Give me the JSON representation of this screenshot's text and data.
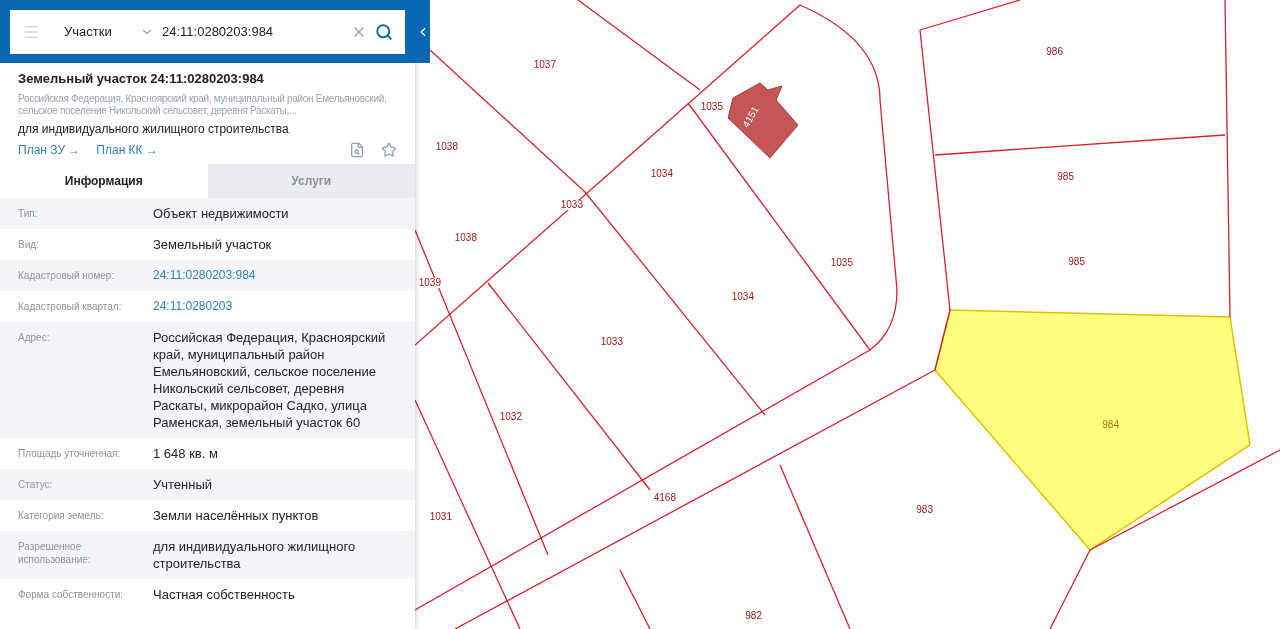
{
  "search": {
    "category": "Участки",
    "value": "24:11:0280203:984"
  },
  "card": {
    "title": "Земельный участок 24:11:0280203:984",
    "address": "Российская Федерация, Красноярский край, муниципальный район Емельяновский, сельское поселение Никольский сельсовет, деревня Раскаты,...",
    "purpose": "для индивидуального жилищного строительства",
    "links": [
      "План ЗУ →",
      "План КК →"
    ]
  },
  "tabs": [
    {
      "label": "Информация",
      "selected": true
    },
    {
      "label": "Услуги",
      "selected": false
    }
  ],
  "rows": [
    {
      "label": "Тип:",
      "value": "Объект недвижимости",
      "kind": "text"
    },
    {
      "label": "Вид:",
      "value": "Земельный участок",
      "kind": "text"
    },
    {
      "label": "Кадастровый номер:",
      "value": "24:11:0280203:984",
      "kind": "link"
    },
    {
      "label": "Кадастровый квартал:",
      "value": "24:11:0280203",
      "kind": "link"
    },
    {
      "label": "Адрес:",
      "value": "Российская Федерация, Красноярский край, муниципальный район Емельяновский, сельское поселение Никольский сельсовет, деревня Раскаты, микрорайон Садко, улица Раменская, земельный участок 60",
      "kind": "text"
    },
    {
      "label": "Площадь уточненная:",
      "value": "1 648 кв. м",
      "kind": "text"
    },
    {
      "label": "Статус:",
      "value": "Учтенный",
      "kind": "text"
    },
    {
      "label": "Категория земель:",
      "value": "Земли населённых пунктов",
      "kind": "text"
    },
    {
      "label": "Разрешенное использование:",
      "value": "для индивидуального жилищного строительства",
      "kind": "text"
    },
    {
      "label": "Форма собственности:",
      "value": "Частная собственность",
      "kind": "text"
    }
  ],
  "map": {
    "labels": [
      "1037",
      "986",
      "1035",
      "4151",
      "1038",
      "1034",
      "985",
      "1033",
      "1038",
      "1035",
      "985",
      "1039",
      "1034",
      "1033",
      "984",
      "1032",
      "4168",
      "983",
      "1031",
      "982"
    ]
  }
}
